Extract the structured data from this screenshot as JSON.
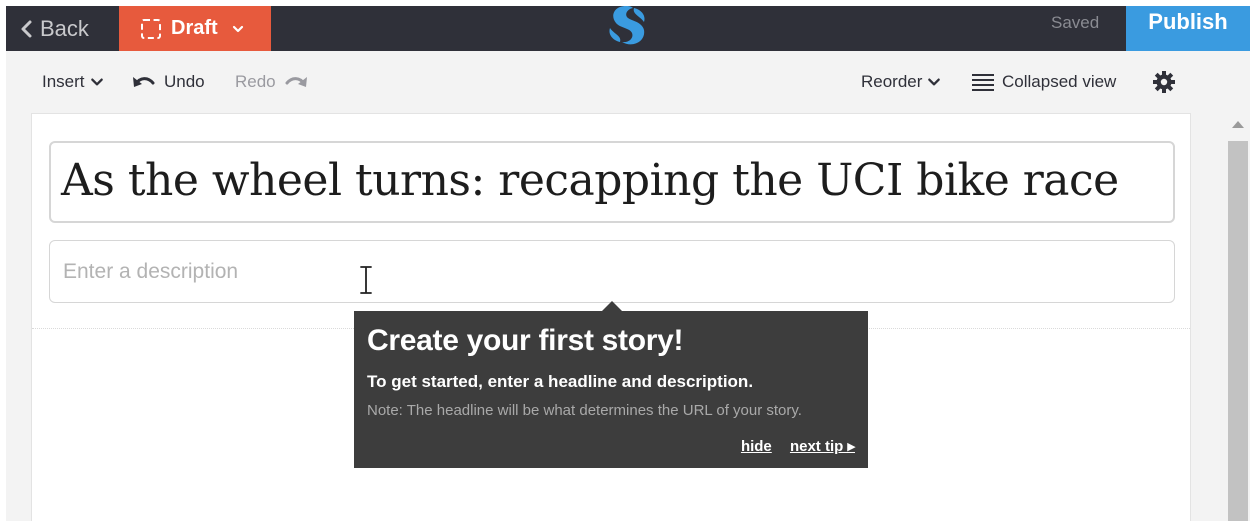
{
  "topbar": {
    "back_label": "Back",
    "draft_label": "Draft",
    "saved_label": "Saved",
    "publish_label": "Publish"
  },
  "toolbar": {
    "insert_label": "Insert",
    "undo_label": "Undo",
    "redo_label": "Redo",
    "reorder_label": "Reorder",
    "collapsed_view_label": "Collapsed view"
  },
  "editor": {
    "headline": "As the wheel turns: recapping the UCI bike race",
    "description_placeholder": "Enter a description"
  },
  "tooltip": {
    "title": "Create your first story!",
    "text": "To get started, enter a headline and description.",
    "note": "Note: The headline will be what determines the URL of your story.",
    "hide_label": "hide",
    "next_tip_label": "next tip ▸"
  },
  "colors": {
    "topbar_bg": "#2f3039",
    "draft_bg": "#e75a3d",
    "publish_bg": "#3a9be0",
    "logo_blue": "#3a9be0",
    "tooltip_bg": "#3d3d3d"
  },
  "icons": [
    "back-chevron-icon",
    "draft-dashed-icon",
    "caret-down-icon",
    "logo-icon",
    "undo-icon",
    "redo-icon",
    "list-icon",
    "gear-icon",
    "text-cursor-icon"
  ]
}
